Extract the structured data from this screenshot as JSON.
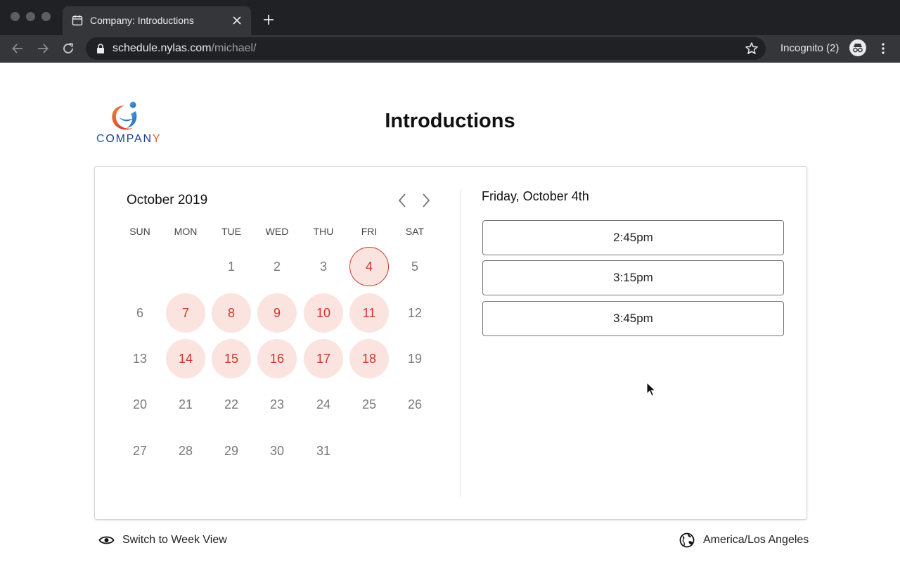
{
  "browser": {
    "tab_title": "Company: Introductions",
    "url_host": "schedule.nylas.com",
    "url_path": "/michael/",
    "incognito_label": "Incognito (2)"
  },
  "logo": {
    "text_first": "C",
    "text_middle": "OMPAN",
    "text_last": "Y"
  },
  "page": {
    "title": "Introductions"
  },
  "calendar": {
    "month_label": "October 2019",
    "weekdays": [
      "SUN",
      "MON",
      "TUE",
      "WED",
      "THU",
      "FRI",
      "SAT"
    ],
    "days": [
      {
        "n": "1",
        "state": "unavailable"
      },
      {
        "n": "2",
        "state": "unavailable"
      },
      {
        "n": "3",
        "state": "unavailable"
      },
      {
        "n": "4",
        "state": "selected"
      },
      {
        "n": "5",
        "state": "unavailable"
      },
      {
        "n": "6",
        "state": "unavailable"
      },
      {
        "n": "7",
        "state": "available"
      },
      {
        "n": "8",
        "state": "available"
      },
      {
        "n": "9",
        "state": "available"
      },
      {
        "n": "10",
        "state": "available"
      },
      {
        "n": "11",
        "state": "available"
      },
      {
        "n": "12",
        "state": "unavailable"
      },
      {
        "n": "13",
        "state": "unavailable"
      },
      {
        "n": "14",
        "state": "available"
      },
      {
        "n": "15",
        "state": "available"
      },
      {
        "n": "16",
        "state": "available"
      },
      {
        "n": "17",
        "state": "available"
      },
      {
        "n": "18",
        "state": "available"
      },
      {
        "n": "19",
        "state": "unavailable"
      },
      {
        "n": "20",
        "state": "unavailable"
      },
      {
        "n": "21",
        "state": "unavailable"
      },
      {
        "n": "22",
        "state": "unavailable"
      },
      {
        "n": "23",
        "state": "unavailable"
      },
      {
        "n": "24",
        "state": "unavailable"
      },
      {
        "n": "25",
        "state": "unavailable"
      },
      {
        "n": "26",
        "state": "unavailable"
      },
      {
        "n": "27",
        "state": "unavailable"
      },
      {
        "n": "28",
        "state": "unavailable"
      },
      {
        "n": "29",
        "state": "unavailable"
      },
      {
        "n": "30",
        "state": "unavailable"
      },
      {
        "n": "31",
        "state": "unavailable"
      }
    ]
  },
  "slots": {
    "selected_date": "Friday, October 4th",
    "times": [
      "2:45pm",
      "3:15pm",
      "3:45pm"
    ]
  },
  "footer": {
    "week_view_label": "Switch to Week View",
    "timezone_label": "America/Los Angeles"
  },
  "colors": {
    "accent": "#c8392c",
    "available_bg": "#fbe3df",
    "chrome_dark": "#202124",
    "chrome_mid": "#35363a"
  },
  "icons": [
    "calendar-tab-icon",
    "close-icon",
    "plus-icon",
    "back-arrow-icon",
    "forward-arrow-icon",
    "reload-icon",
    "lock-icon",
    "star-icon",
    "incognito-icon",
    "menu-dots-icon",
    "chevron-left-icon",
    "chevron-right-icon",
    "eye-icon",
    "globe-icon",
    "cursor-icon"
  ]
}
